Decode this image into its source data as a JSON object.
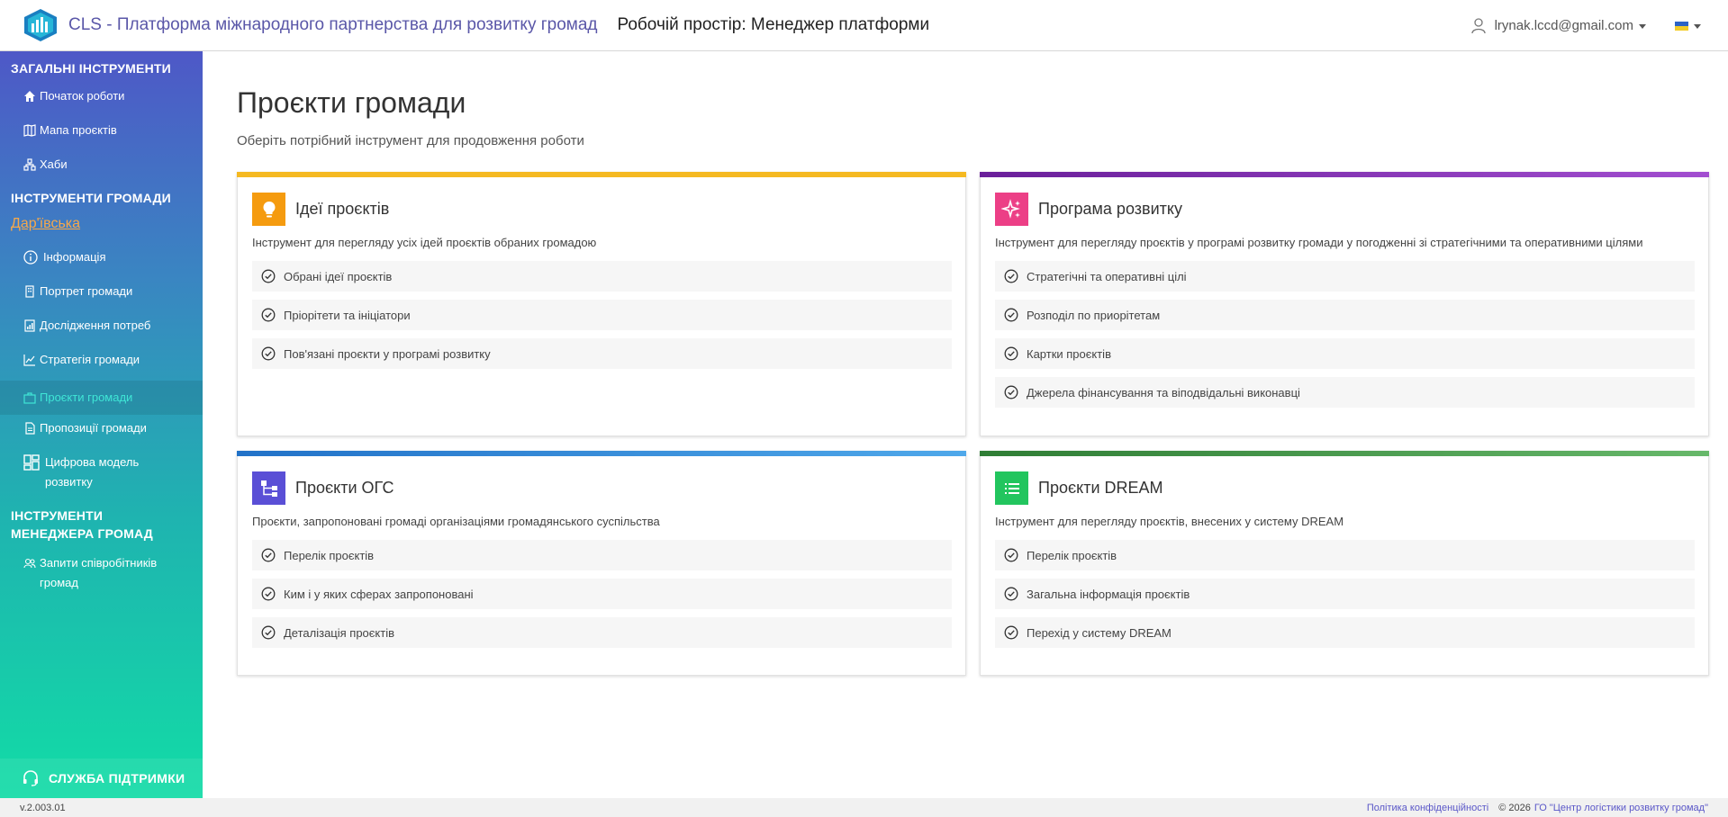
{
  "header": {
    "app_title": "CLS - Платформа міжнародного партнерства для розвитку громад",
    "workspace": "Робочій простір: Менеджер платформи",
    "user_email": "lrynak.lccd@gmail.com",
    "flag_colors": [
      "#2c63c7",
      "#f3cc28"
    ]
  },
  "sidebar": {
    "section_general": "ЗАГАЛЬНІ ІНСТРУМЕНТИ",
    "general_items": [
      "Початок роботи",
      "Мапа проєктів",
      "Хаби"
    ],
    "section_community": "ІНСТРУМЕНТИ ГРОМАДИ",
    "community_name": "Дар'ївська",
    "community_items": [
      "Інформація",
      "Портрет громади",
      "Дослідження потреб",
      "Стратегія громади",
      "Проєкти громади",
      "Пропозиції громади",
      "Цифрова модель розвитку"
    ],
    "active_item": "Проєкти громади",
    "section_manager": "ІНСТРУМЕНТИ МЕНЕДЖЕРА ГРОМАД",
    "manager_items": [
      "Запити співробітників громад"
    ],
    "support_label": "СЛУЖБА ПІДТРИМКИ"
  },
  "main": {
    "title": "Проєкти громади",
    "subtitle": "Оберіть потрібний інструмент для продовження роботи",
    "cards": [
      {
        "title": "Ідеї проєктів",
        "desc": "Інструмент для перегляду усіх ідей проєктів обраних громадою",
        "accent": "#f5b921",
        "icon_bg": "#f59b0f",
        "icon": "lightbulb-icon",
        "items": [
          "Обрані ідеї проєктів",
          "Пріорітети та ініціатори",
          "Пов'язані проєкти у програмі розвитку"
        ]
      },
      {
        "title": "Програма розвитку",
        "desc": "Інструмент для перегляду проєктів у програмі розвитку громади у погодженні зі стратегічними та оперативними цілями",
        "accent": "#8a3bb5",
        "icon_bg": "#ec3f86",
        "icon": "sparkles-icon",
        "items": [
          "Стратегічні та оперативні цілі",
          "Розподіл по приорітетам",
          "Картки проєктів",
          "Джерела фінансування та віподвідальні виконавці"
        ]
      },
      {
        "title": "Проєкти ОГС",
        "desc": "Проєкти, запропоновані громаді організаціями громадянського суспільства",
        "accent": "#2d8ad8",
        "icon_bg": "#5a4fd6",
        "icon": "hierarchy-icon",
        "items": [
          "Перелік проєктів",
          "Ким і у яких сферах запропоновані",
          "Деталізація проєктів"
        ]
      },
      {
        "title": "Проєкти DREAM",
        "desc": "Інструмент для перегляду проєктів, внесених у систему DREAM",
        "accent": "#3e9a45",
        "icon_bg": "#22c55e",
        "icon": "list-icon",
        "items": [
          "Перелік проєктів",
          "Загальна інформація проєктів",
          "Перехід у систему DREAM"
        ]
      }
    ]
  },
  "footer": {
    "version": "v.2.003.01",
    "privacy": "Політика конфіденційності",
    "copyright": "© 2026",
    "org": "ГО \"Центр логістики розвитку громад\""
  }
}
